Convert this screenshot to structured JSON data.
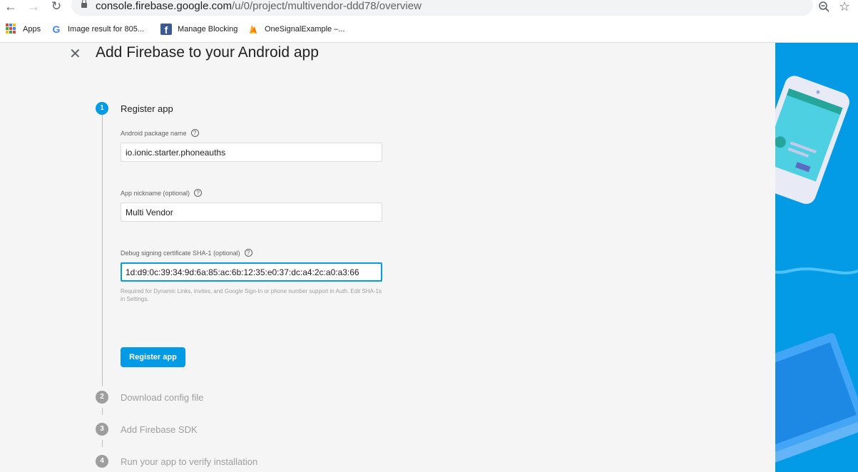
{
  "browser": {
    "url_host": "console.firebase.google.com",
    "url_path": "/u/0/project/multivendor-ddd78/overview",
    "bookmarks": [
      {
        "label": "Apps",
        "icon": "apps-grid-icon"
      },
      {
        "label": "Image result for 805...",
        "icon": "google-icon"
      },
      {
        "label": "Manage Blocking",
        "icon": "facebook-icon"
      },
      {
        "label": "OneSignalExample –...",
        "icon": "firebase-icon"
      }
    ]
  },
  "page": {
    "title": "Add Firebase to your Android app"
  },
  "steps": [
    {
      "num": "1",
      "label": "Register app",
      "active": true
    },
    {
      "num": "2",
      "label": "Download config file",
      "active": false
    },
    {
      "num": "3",
      "label": "Add Firebase SDK",
      "active": false
    },
    {
      "num": "4",
      "label": "Run your app to verify installation",
      "active": false
    }
  ],
  "form": {
    "package_label": "Android package name",
    "package_value": "io.ionic.starter.phoneauths",
    "nickname_label": "App nickname (optional)",
    "nickname_value": "Multi Vendor",
    "sha_label": "Debug signing certificate SHA-1 (optional)",
    "sha_value": "1d:d9:0c:39:34:9d:6a:85:ac:6b:12:35:e0:37:dc:a4:2c:a0:a3:66",
    "hint": "Required for Dynamic Links, Invites, and Google Sign-In or phone number support in Auth. Edit SHA-1s in Settings.",
    "register_button": "Register app"
  },
  "colors": {
    "accent": "#039be5",
    "panel": "#039be5",
    "background": "#f5f5f5"
  }
}
